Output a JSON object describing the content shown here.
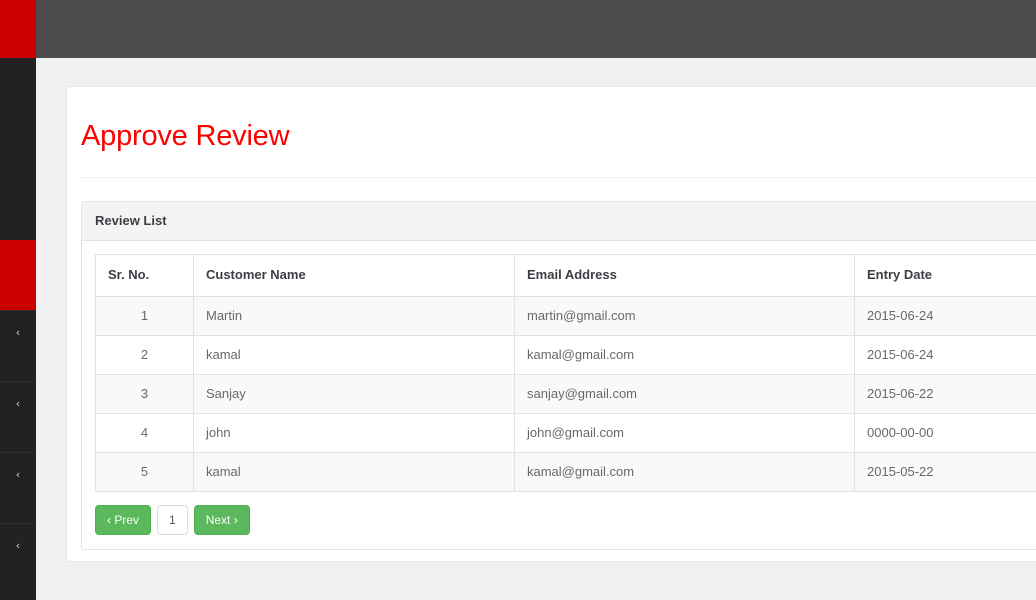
{
  "theme": {
    "brand_red": "#cc0000",
    "topbar_gray": "#4c4c4c",
    "sidebar_dark": "#222222",
    "title_red": "#fe0000",
    "button_green": "#5cb85c",
    "page_bg": "#f1f1f1"
  },
  "topbar": {
    "brand_label": ""
  },
  "sidebar": {
    "items": [
      {
        "icon": "chevron-left-icon",
        "glyph": "‹",
        "label": ""
      },
      {
        "icon": "chevron-left-icon",
        "glyph": "‹",
        "label": ""
      },
      {
        "icon": "chevron-left-icon",
        "glyph": "‹",
        "label": ""
      },
      {
        "icon": "chevron-left-icon",
        "glyph": "‹",
        "label": ""
      }
    ]
  },
  "page": {
    "title": "Approve Review"
  },
  "panel": {
    "title": "Review List"
  },
  "table": {
    "headers": [
      "Sr. No.",
      "Customer Name",
      "Email Address",
      "Entry Date"
    ],
    "rows": [
      {
        "sr": "1",
        "name": "Martin",
        "email": "martin@gmail.com",
        "date": "2015-06-24"
      },
      {
        "sr": "2",
        "name": "kamal",
        "email": "kamal@gmail.com",
        "date": "2015-06-24"
      },
      {
        "sr": "3",
        "name": "Sanjay",
        "email": "sanjay@gmail.com",
        "date": "2015-06-22"
      },
      {
        "sr": "4",
        "name": "john",
        "email": "john@gmail.com",
        "date": "0000-00-00"
      },
      {
        "sr": "5",
        "name": "kamal",
        "email": "kamal@gmail.com",
        "date": "2015-05-22"
      }
    ]
  },
  "pagination": {
    "prev_label": "‹ Prev",
    "current_page": "1",
    "next_label": "Next ›"
  }
}
